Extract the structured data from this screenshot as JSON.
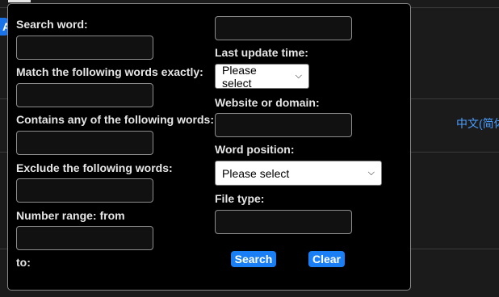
{
  "background": {
    "badge_text": "A",
    "language_link": "中文(简体"
  },
  "form": {
    "search_word_label": "Search word:",
    "match_exact_label": "Match the following words exactly:",
    "contains_any_label": "Contains any of the following words:",
    "exclude_label": "Exclude the following words:",
    "number_from_label": "Number range: from",
    "number_to_label": "to:",
    "last_update_label": "Last update time:",
    "last_update_value": "Please select",
    "website_label": "Website or domain:",
    "word_position_label": "Word position:",
    "word_position_value": "Please select",
    "file_type_label": "File type:",
    "search_button": "Search",
    "clear_button": "Clear"
  }
}
